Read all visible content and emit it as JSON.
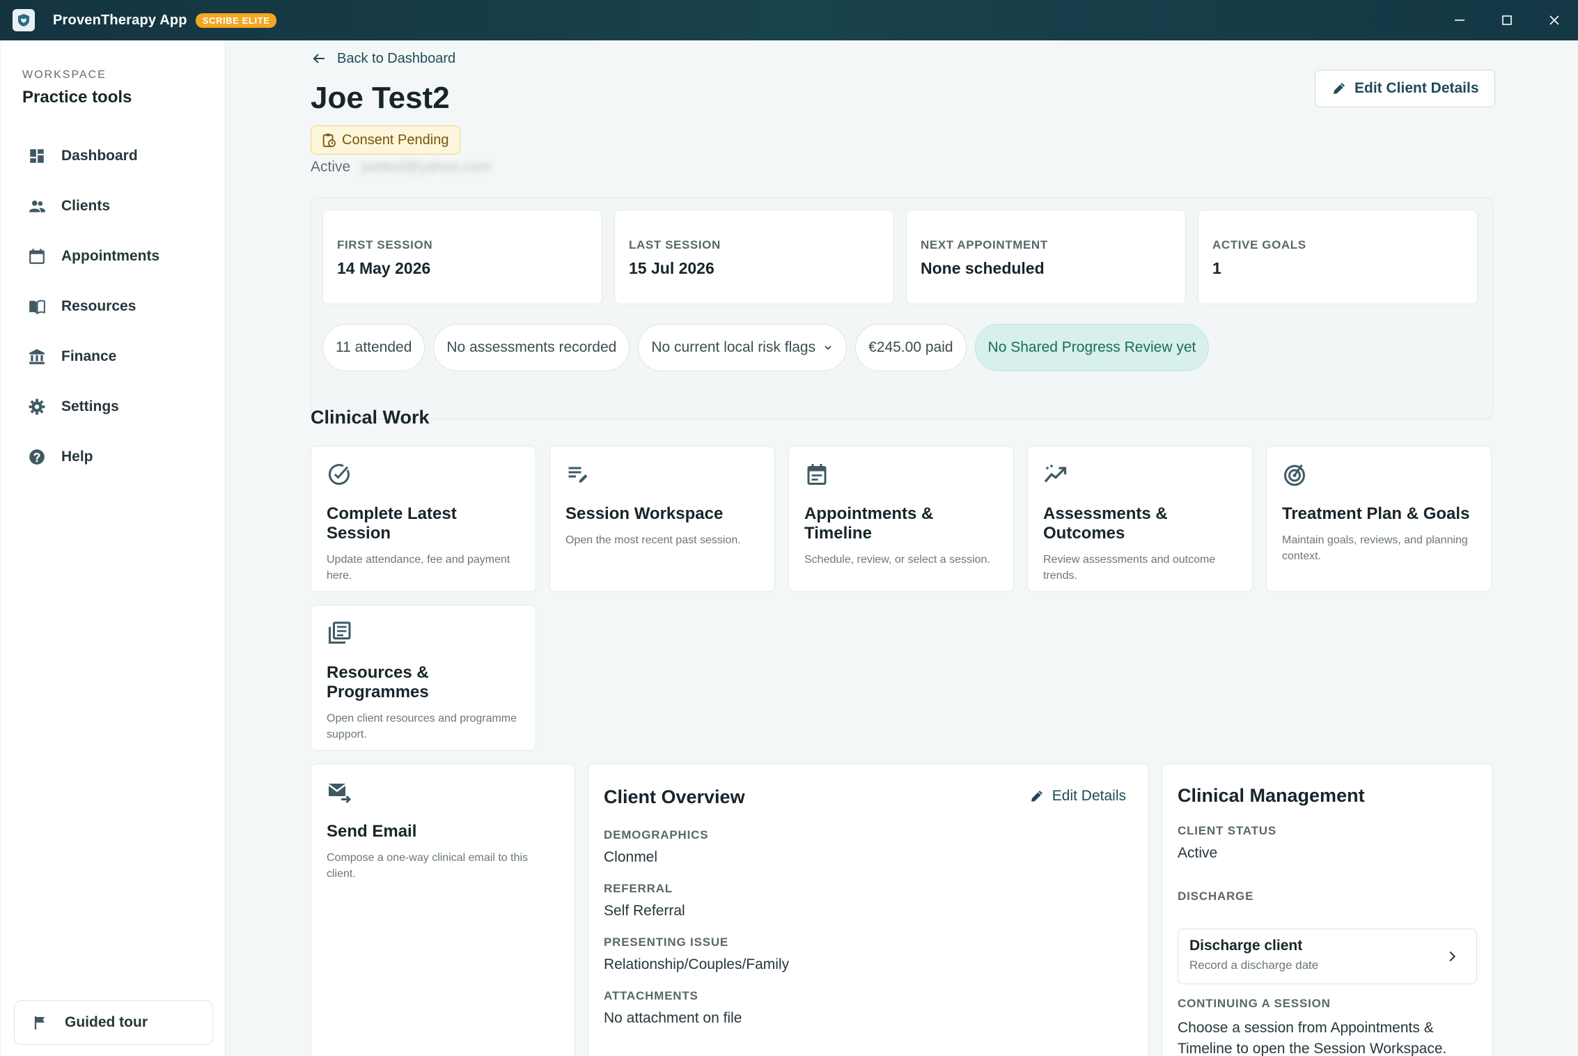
{
  "app": {
    "title": "ProvenTherapy App",
    "badge": "SCRIBE ELITE"
  },
  "sidebar": {
    "workspace_label": "WORKSPACE",
    "workspace_title": "Practice tools",
    "items": [
      {
        "label": "Dashboard",
        "icon": "dashboard-icon"
      },
      {
        "label": "Clients",
        "icon": "people-icon"
      },
      {
        "label": "Appointments",
        "icon": "calendar-icon"
      },
      {
        "label": "Resources",
        "icon": "book-icon"
      },
      {
        "label": "Finance",
        "icon": "bank-icon"
      },
      {
        "label": "Settings",
        "icon": "gear-icon"
      },
      {
        "label": "Help",
        "icon": "help-icon"
      }
    ],
    "guided_tour": "Guided tour"
  },
  "header": {
    "back_label": "Back to Dashboard",
    "client_name": "Joe Test2",
    "consent_badge": "Consent Pending",
    "status": "Active",
    "email": "joetest@yahoo.com",
    "edit_button": "Edit Client Details"
  },
  "stats": [
    {
      "label": "FIRST SESSION",
      "value": "14 May 2026"
    },
    {
      "label": "LAST SESSION",
      "value": "15 Jul 2026"
    },
    {
      "label": "NEXT APPOINTMENT",
      "value": "None scheduled"
    },
    {
      "label": "ACTIVE GOALS",
      "value": "1"
    }
  ],
  "pills": [
    {
      "label": "11 attended"
    },
    {
      "label": "No assessments recorded"
    },
    {
      "label": "No current local risk flags"
    },
    {
      "label": "€245.00 paid"
    },
    {
      "label": "No Shared Progress Review yet"
    }
  ],
  "clinical_work": {
    "title": "Clinical Work",
    "tiles": [
      {
        "title": "Complete Latest Session",
        "desc": "Update attendance, fee and payment here.",
        "icon": "check-circle-icon"
      },
      {
        "title": "Session Workspace",
        "desc": "Open the most recent past session.",
        "icon": "edit-notes-icon"
      },
      {
        "title": "Appointments & Timeline",
        "desc": "Schedule, review, or select a session.",
        "icon": "event-note-icon"
      },
      {
        "title": "Assessments & Outcomes",
        "desc": "Review assessments and outcome trends.",
        "icon": "trending-icon"
      },
      {
        "title": "Treatment Plan & Goals",
        "desc": "Maintain goals, reviews, and planning context.",
        "icon": "target-icon"
      },
      {
        "title": "Resources & Programmes",
        "desc": "Open client resources and programme support.",
        "icon": "library-icon"
      }
    ]
  },
  "send_email": {
    "title": "Send Email",
    "desc": "Compose a one-way clinical email to this client."
  },
  "overview": {
    "title": "Client Overview",
    "edit_label": "Edit Details",
    "fields": [
      {
        "label": "DEMOGRAPHICS",
        "value": "Clonmel"
      },
      {
        "label": "REFERRAL",
        "value": "Self Referral"
      },
      {
        "label": "PRESENTING ISSUE",
        "value": "Relationship/Couples/Family"
      },
      {
        "label": "ATTACHMENTS",
        "value": "No attachment on file"
      }
    ]
  },
  "management": {
    "title": "Clinical Management",
    "client_status_label": "CLIENT STATUS",
    "client_status_value": "Active",
    "discharge_label": "DISCHARGE",
    "discharge_title": "Discharge client",
    "discharge_sub": "Record a discharge date",
    "continuing_label": "CONTINUING A SESSION",
    "continuing_text": "Choose a session from Appointments & Timeline to open the Session Workspace."
  },
  "colors": {
    "titlebar": "#143440",
    "accent": "#1f4a57",
    "badge": "#f5a623",
    "consent_bg": "#fdf5dc",
    "teal_pill": "#d7f0ec"
  }
}
